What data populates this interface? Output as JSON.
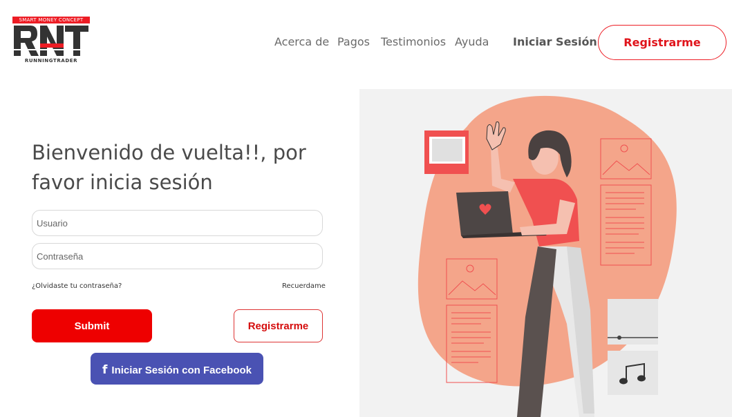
{
  "logo": {
    "top_text": "SMART MONEY CONCEPT",
    "mark_text": "RNT",
    "bottom_text": "RUNNINGTRADER"
  },
  "nav": {
    "about": "Acerca de",
    "payments": "Pagos",
    "testimonials": "Testimonios",
    "help": "Ayuda",
    "login": "Iniciar Sesión",
    "register": "Registrarme"
  },
  "form": {
    "title": "Bienvenido de vuelta!!, por favor inicia sesión",
    "username_placeholder": "Usuario",
    "password_placeholder": "Contraseña",
    "forgot": "¿Olvidaste tu contraseña?",
    "remember": "Recuerdame",
    "submit": "Submit",
    "register": "Registrarme",
    "facebook": "Iniciar Sesión con Facebook",
    "facebook_icon": "f"
  },
  "colors": {
    "brand_red": "#ed1c24",
    "facebook_blue": "#4a52b3",
    "blob": "#f4a58a",
    "shirt": "#f05050"
  }
}
